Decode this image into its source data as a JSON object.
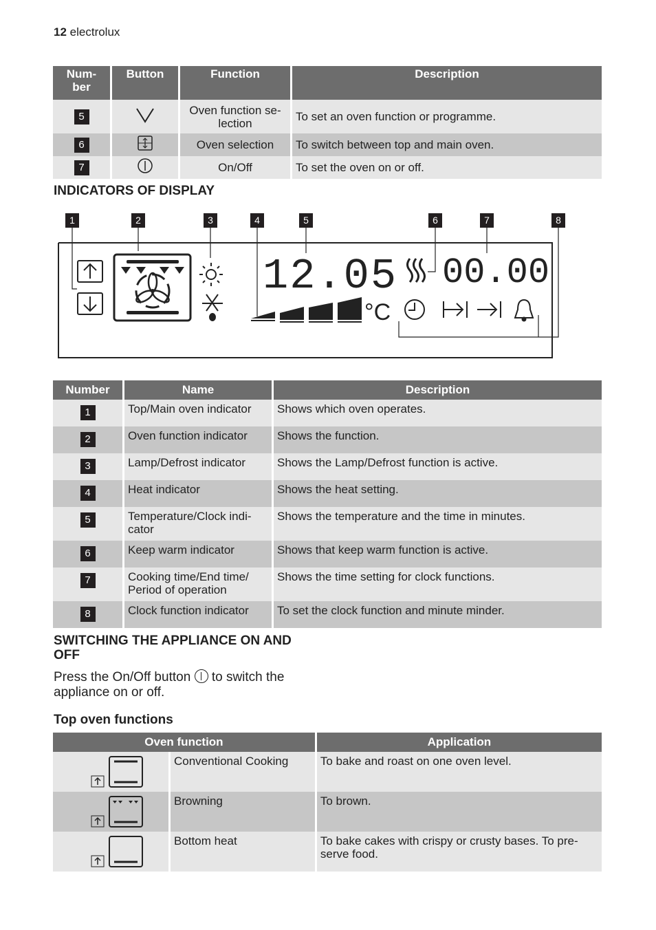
{
  "header": {
    "page_number": "12",
    "brand": "electrolux"
  },
  "buttons_table": {
    "columns": [
      "Num-\nber",
      "Button",
      "Function",
      "Description"
    ],
    "rows": [
      {
        "number": "5",
        "button_icon": "chevron-down-icon",
        "function": "Oven function se-\nlection",
        "description": "To set an oven function or programme."
      },
      {
        "number": "6",
        "button_icon": "oven-selection-icon",
        "function": "Oven selection",
        "description": "To switch between top and main oven."
      },
      {
        "number": "7",
        "button_icon": "power-icon",
        "function": "On/Off",
        "description": "To set the oven on or off."
      }
    ]
  },
  "display_section": {
    "title": "INDICATORS OF DISPLAY",
    "callouts": [
      "1",
      "2",
      "3",
      "4",
      "5",
      "6",
      "7",
      "8"
    ],
    "temperature_readout": "12.05",
    "temperature_unit": "°C",
    "clock_readout": "00.00"
  },
  "indicators_table": {
    "columns": [
      "Number",
      "Name",
      "Description"
    ],
    "rows": [
      {
        "number": "1",
        "name": "Top/Main oven indicator",
        "description": "Shows which oven operates."
      },
      {
        "number": "2",
        "name": "Oven function indicator",
        "description": "Shows the function."
      },
      {
        "number": "3",
        "name": "Lamp/Defrost indicator",
        "description": "Shows the Lamp/Defrost function is active."
      },
      {
        "number": "4",
        "name": "Heat indicator",
        "description": "Shows the heat setting."
      },
      {
        "number": "5",
        "name": "Temperature/Clock indi-\ncator",
        "description": "Shows the temperature and the time in minutes."
      },
      {
        "number": "6",
        "name": "Keep warm indicator",
        "description": "Shows that keep warm function is active."
      },
      {
        "number": "7",
        "name": "Cooking time/End time/\nPeriod of operation",
        "description": "Shows the time setting for clock functions."
      },
      {
        "number": "8",
        "name": "Clock function indicator",
        "description": "To set the clock function and minute minder."
      }
    ]
  },
  "switching_section": {
    "title": "SWITCHING THE APPLIANCE ON AND\nOFF",
    "text_before": "Press the On/Off button",
    "text_after": "to switch the\nappliance on or off."
  },
  "top_oven_section": {
    "title": "Top oven functions",
    "columns": [
      "Oven function",
      "Application"
    ],
    "rows": [
      {
        "icon": "conventional-cooking-icon",
        "function": "Conventional Cooking",
        "application": "To bake and roast on one oven level."
      },
      {
        "icon": "browning-icon",
        "function": "Browning",
        "application": "To brown."
      },
      {
        "icon": "bottom-heat-icon",
        "function": "Bottom heat",
        "application": "To bake cakes with crispy or crusty bases. To pre-\nserve food."
      }
    ]
  }
}
